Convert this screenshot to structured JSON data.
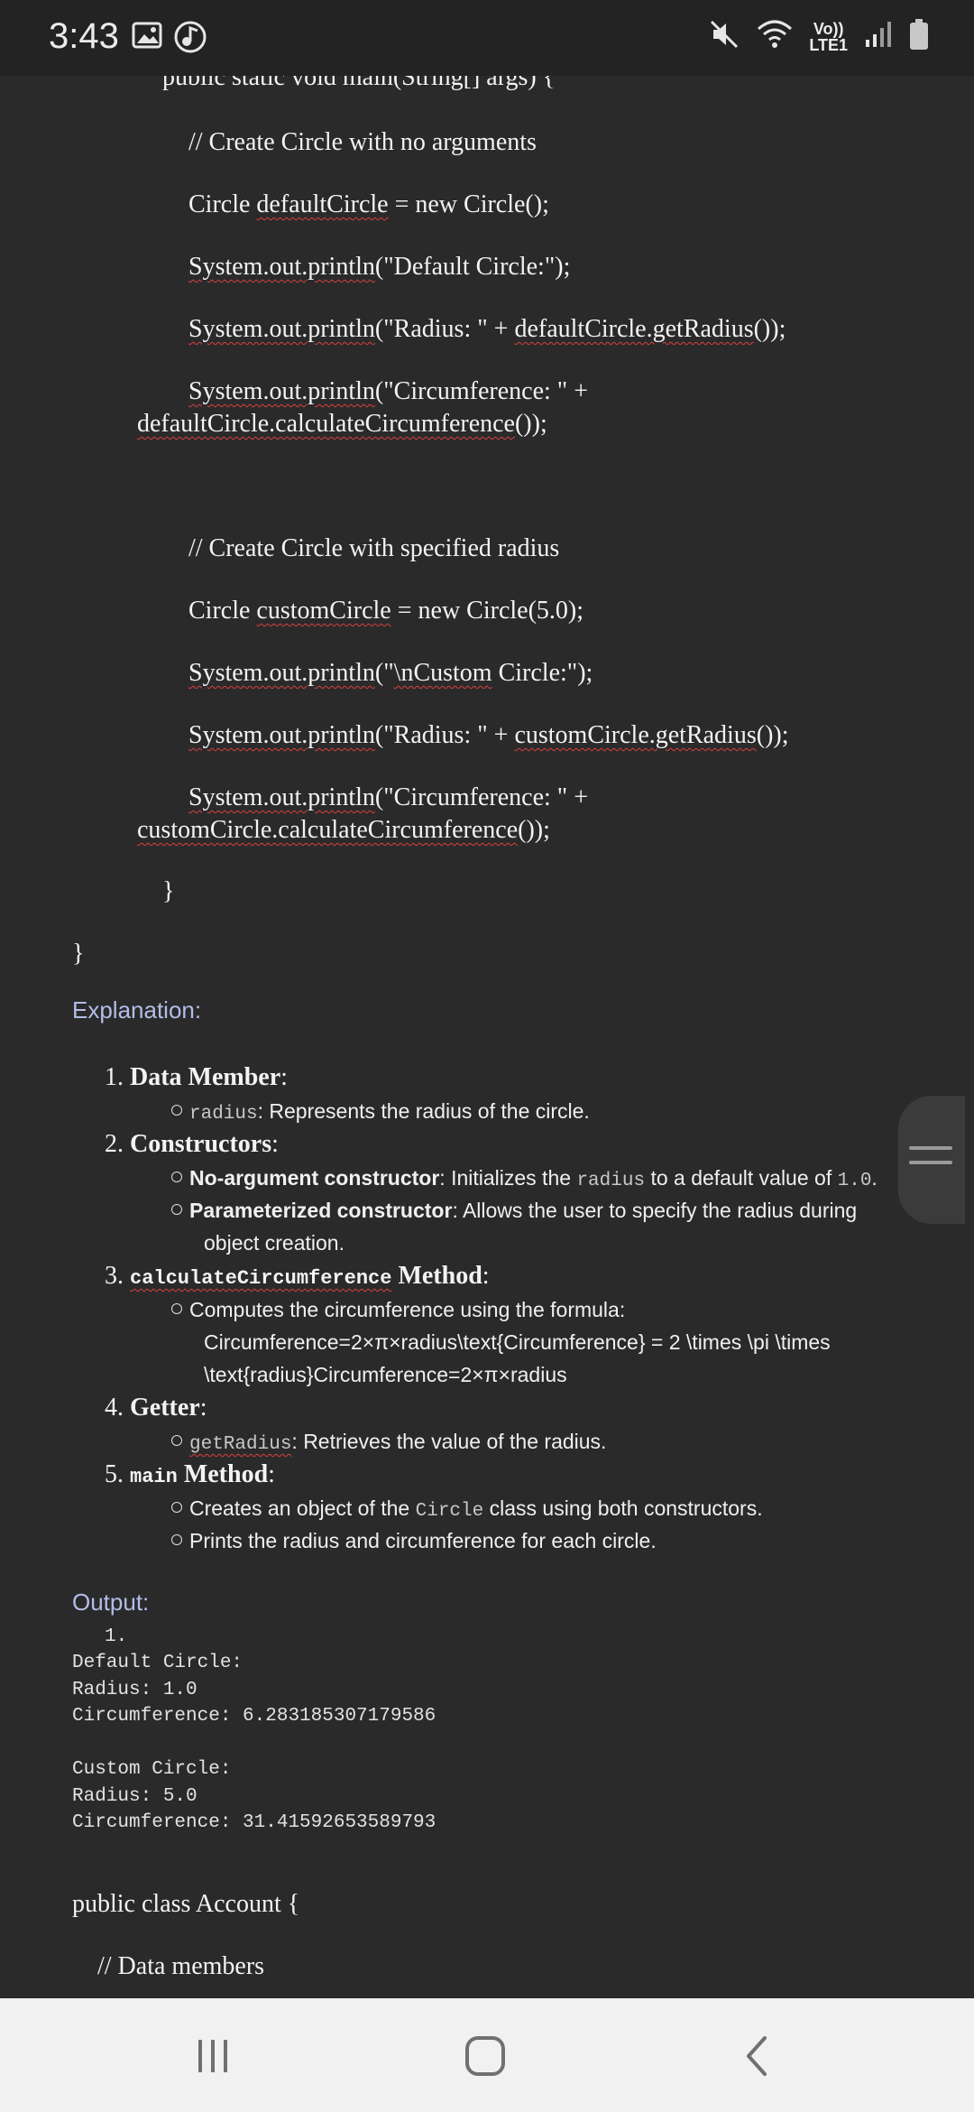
{
  "status_bar": {
    "time": "3:43",
    "network_top": "Vo))",
    "network_bottom": "LTE1",
    "icons": [
      "gallery-icon",
      "music-icon",
      "mute-icon",
      "wifi-icon",
      "signal-icon",
      "battery-icon"
    ]
  },
  "code_top": {
    "line1": "public static void main(String[] args) {",
    "line2": "// Create Circle with no arguments",
    "line3a": "Circle ",
    "line3b": "defaultCircle",
    "line3c": " = new Circle();",
    "line4a": "System.out.println",
    "line4b": "(\"Default Circle:\");",
    "line5a": "System.out.println",
    "line5b": "(\"Radius: \" + ",
    "line5c": "defaultCircle.getRadius",
    "line5d": "());",
    "line6a": "System.out.println",
    "line6b": "(\"Circumference: \" +",
    "line7a": "defaultCircle.calculateCircumference",
    "line7b": "());",
    "line8": "// Create Circle with specified radius",
    "line9a": "Circle ",
    "line9b": "customCircle",
    "line9c": " = new Circle(5.0);",
    "line10a": "System.out.println",
    "line10b": "(\"",
    "line10c": "\\nCustom",
    "line10d": " Circle:\");",
    "line11a": "System.out.println",
    "line11b": "(\"Radius: \" + ",
    "line11c": "customCircle.getRadius",
    "line11d": "());",
    "line12a": "System.out.println",
    "line12b": "(\"Circumference: \" +",
    "line13a": "customCircle.calculateCircumference",
    "line13b": "());",
    "line14": "}",
    "line15": "}"
  },
  "explanation": {
    "heading": "Explanation:",
    "item1": {
      "num": "1.",
      "title": "Data Member",
      "colon": ":",
      "bullet1_code": "radius",
      "bullet1_text": ": Represents the radius of the circle."
    },
    "item2": {
      "num": "2.",
      "title": "Constructors",
      "colon": ":",
      "bullet1_bold": "No-argument constructor",
      "bullet1_text_a": ": Initializes the ",
      "bullet1_code": "radius",
      "bullet1_text_b": " to a default value of ",
      "bullet1_code2": "1.0",
      "bullet1_text_c": ".",
      "bullet2_bold": "Parameterized constructor",
      "bullet2_text": ": Allows the user to specify the radius during",
      "bullet2_cont": "object creation."
    },
    "item3": {
      "num": "3.",
      "code": "calculateCircumference",
      "title": " Method",
      "colon": ":",
      "bullet1_text": "Computes the circumference using the formula:",
      "bullet1_cont1": "Circumference=2×π×radius\\text{Circumference} = 2 \\times \\pi \\times",
      "bullet1_cont2": "\\text{radius}Circumference=2×π×radius"
    },
    "item4": {
      "num": "4.",
      "title": "Getter",
      "colon": ":",
      "bullet1_code": "getRadius",
      "bullet1_text": ": Retrieves the value of the radius."
    },
    "item5": {
      "num": "5.",
      "code": "main",
      "title": " Method",
      "colon": ":",
      "bullet1_text_a": "Creates an object of the ",
      "bullet1_code": "Circle",
      "bullet1_text_b": " class using both constructors.",
      "bullet2_text": "Prints the radius and circumference for each circle."
    }
  },
  "output": {
    "heading": "Output:",
    "num": "1.",
    "lines": [
      "Default Circle:",
      "Radius: 1.0",
      "Circumference: 6.283185307179586",
      "",
      "Custom Circle:",
      "Radius: 5.0",
      "Circumference: 31.41592653589793"
    ]
  },
  "code_bottom": {
    "line1": "public class Account {",
    "line2": "// Data members"
  }
}
